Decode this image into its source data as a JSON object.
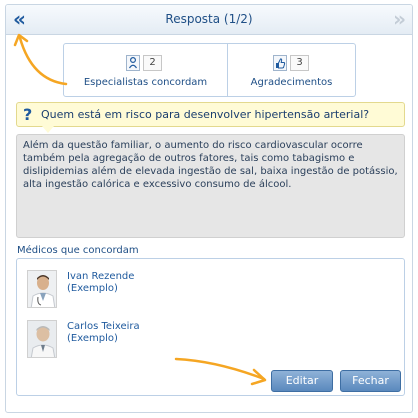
{
  "header": {
    "title": "Resposta (1/2)",
    "back_glyph": "«",
    "next_glyph": "»"
  },
  "stats": {
    "specialists_count": "2",
    "specialists_label": "Especialistas concordam",
    "thanks_count": "3",
    "thanks_label": "Agradecimentos"
  },
  "question": {
    "mark": "?",
    "text": "Quem está em risco para desenvolver hipertensão arterial?"
  },
  "answer": {
    "text": "Além da questão familiar, o aumento do risco cardiovascular ocorre também pela agregação de outros fatores, tais como tabagismo e dislipidemias além de elevada ingestão de sal, baixa ingestão de potássio, alta ingestão calórica e excessivo consumo de álcool."
  },
  "doctors": {
    "label": "Médicos que concordam",
    "items": [
      {
        "name": "Ivan Rezende",
        "note": "(Exemplo)"
      },
      {
        "name": "Carlos Teixeira",
        "note": "(Exemplo)"
      }
    ]
  },
  "buttons": {
    "edit": "Editar",
    "close": "Fechar"
  },
  "colors": {
    "accent": "#1f5a9e",
    "annotation_arrow": "#f5a623",
    "question_bg": "#fffbd6",
    "answer_bg": "#e6e6e6"
  }
}
